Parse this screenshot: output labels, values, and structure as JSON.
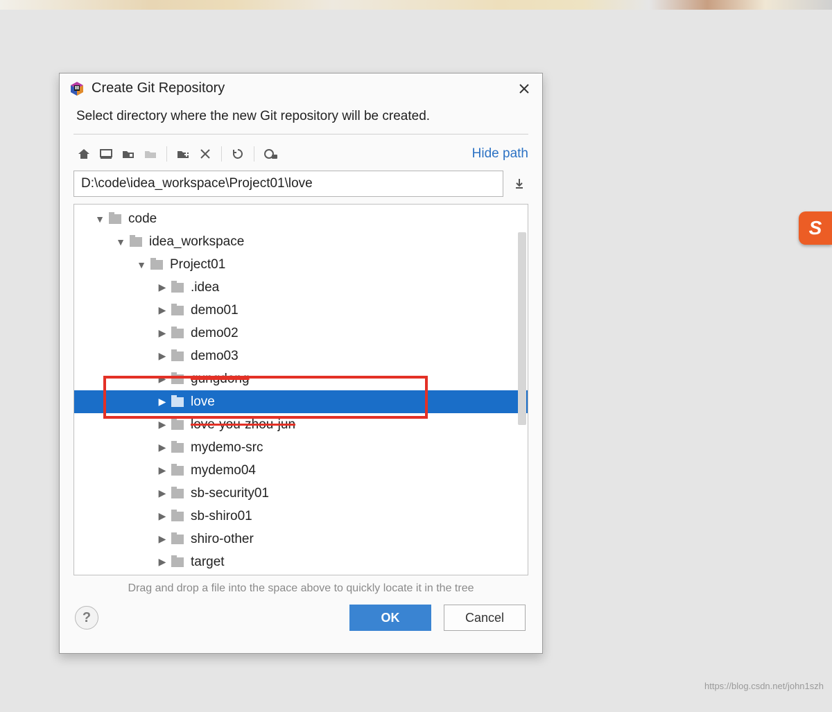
{
  "badge_letter": "S",
  "watermark": "https://blog.csdn.net/john1szh",
  "dialog": {
    "title": "Create Git Repository",
    "subtitle": "Select directory where the new Git repository will be created.",
    "hide_path_label": "Hide path",
    "path_value": "D:\\code\\idea_workspace\\Project01\\love",
    "hint": "Drag and drop a file into the space above to quickly locate it in the tree",
    "buttons": {
      "ok": "OK",
      "cancel": "Cancel",
      "help": "?"
    }
  },
  "tree": {
    "items": [
      {
        "label": "code",
        "indent": 0,
        "expanded": true,
        "selected": false
      },
      {
        "label": "idea_workspace",
        "indent": 1,
        "expanded": true,
        "selected": false
      },
      {
        "label": "Project01",
        "indent": 2,
        "expanded": true,
        "selected": false
      },
      {
        "label": ".idea",
        "indent": 3,
        "expanded": false,
        "selected": false
      },
      {
        "label": "demo01",
        "indent": 3,
        "expanded": false,
        "selected": false
      },
      {
        "label": "demo02",
        "indent": 3,
        "expanded": false,
        "selected": false
      },
      {
        "label": "demo03",
        "indent": 3,
        "expanded": false,
        "selected": false
      },
      {
        "label": "gungdong",
        "indent": 3,
        "expanded": false,
        "selected": false,
        "strike": true
      },
      {
        "label": "love",
        "indent": 3,
        "expanded": false,
        "selected": true
      },
      {
        "label": "love-you-zhou-jun",
        "indent": 3,
        "expanded": false,
        "selected": false,
        "strike": true
      },
      {
        "label": "mydemo-src",
        "indent": 3,
        "expanded": false,
        "selected": false
      },
      {
        "label": "mydemo04",
        "indent": 3,
        "expanded": false,
        "selected": false
      },
      {
        "label": "sb-security01",
        "indent": 3,
        "expanded": false,
        "selected": false
      },
      {
        "label": "sb-shiro01",
        "indent": 3,
        "expanded": false,
        "selected": false
      },
      {
        "label": "shiro-other",
        "indent": 3,
        "expanded": false,
        "selected": false
      },
      {
        "label": "target",
        "indent": 3,
        "expanded": false,
        "selected": false
      }
    ]
  }
}
